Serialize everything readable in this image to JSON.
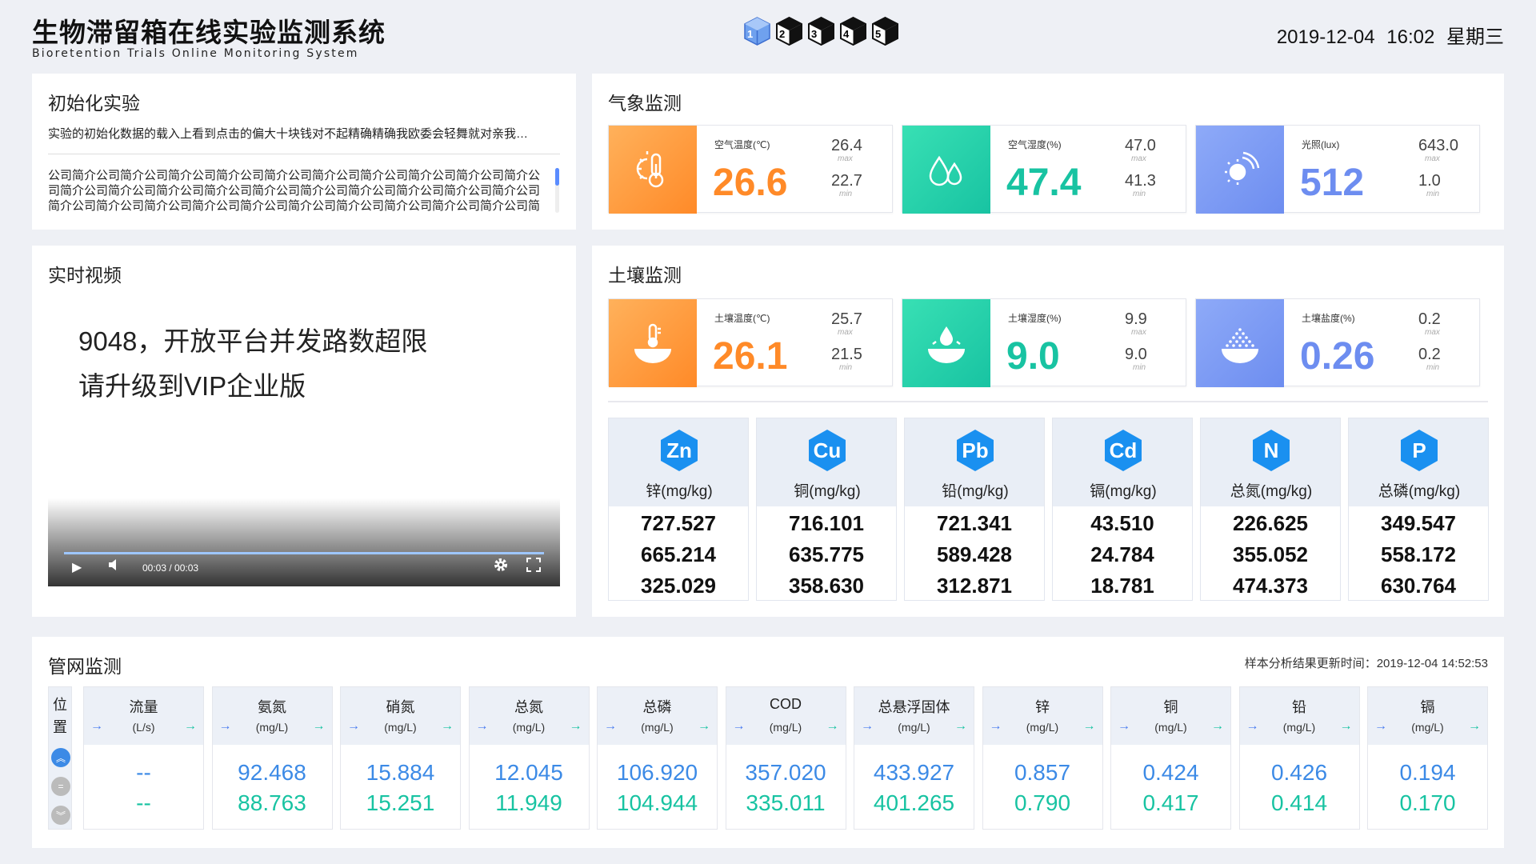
{
  "header": {
    "title_cn": "生物滞留箱在线实验监测系统",
    "title_en": "Bioretention Trials Online Monitoring System",
    "cubes": [
      "1",
      "2",
      "3",
      "4",
      "5"
    ],
    "datetime": "2019-12-04  16:02  星期三"
  },
  "init": {
    "title": "初始化实验",
    "summary": "实验的初始化数据的载入上看到点击的偏大十块钱对不起精确精确我欧委会轻舞就对亲我…",
    "body": "公司简介公司简介公司简介公司简介公司简介公司简介公司简介公司简介公司简介公司简介公司简介公司简介公司简介公司简介公司简介公司简介公司简介公司简介公司简介公司简介公司简介公司简介公司简介公司简介公司简介公司简介公司简介公司简介公司简介公司简介公司简介公司简介公司简介公司简介公司简介公司简介公司简介公司简介公司简介公司简介公"
  },
  "video": {
    "title": "实时视频",
    "message_line1": "9048，开放平台并发路数超限",
    "message_line2": "请升级到VIP企业版",
    "time": "00:03 / 00:03"
  },
  "weather": {
    "title": "气象监测",
    "cards": [
      {
        "label": "空气温度(℃)",
        "value": "26.6",
        "max": "26.4",
        "min": "22.7",
        "icon": "thermometer-sun-icon",
        "color": "#ff8a28"
      },
      {
        "label": "空气湿度(%)",
        "value": "47.4",
        "max": "47.0",
        "min": "41.3",
        "icon": "water-drops-icon",
        "color": "#18c3a2"
      },
      {
        "label": "光照(lux)",
        "value": "512",
        "max": "643.0",
        "min": "1.0",
        "icon": "sun-icon",
        "color": "#6d8df0"
      }
    ]
  },
  "soil": {
    "title": "土壤监测",
    "cards": [
      {
        "label": "土壤温度(℃)",
        "value": "26.1",
        "max": "25.7",
        "min": "21.5",
        "icon": "soil-temperature-icon"
      },
      {
        "label": "土壤湿度(%)",
        "value": "9.0",
        "max": "9.9",
        "min": "9.0",
        "icon": "soil-moisture-icon"
      },
      {
        "label": "土壤盐度(%)",
        "value": "0.26",
        "max": "0.2",
        "min": "0.2",
        "icon": "soil-salinity-icon"
      }
    ],
    "elements": [
      {
        "symbol": "Zn",
        "name": "锌(mg/kg)",
        "values": [
          "727.527",
          "665.214",
          "325.029"
        ]
      },
      {
        "symbol": "Cu",
        "name": "铜(mg/kg)",
        "values": [
          "716.101",
          "635.775",
          "358.630"
        ]
      },
      {
        "symbol": "Pb",
        "name": "铅(mg/kg)",
        "values": [
          "721.341",
          "589.428",
          "312.871"
        ]
      },
      {
        "symbol": "Cd",
        "name": "镉(mg/kg)",
        "values": [
          "43.510",
          "24.784",
          "18.781"
        ]
      },
      {
        "symbol": "N",
        "name": "总氮(mg/kg)",
        "values": [
          "226.625",
          "355.052",
          "474.373"
        ]
      },
      {
        "symbol": "P",
        "name": "总磷(mg/kg)",
        "values": [
          "349.547",
          "558.172",
          "630.764"
        ]
      }
    ]
  },
  "labels": {
    "max": "max",
    "min": "min"
  },
  "pipe": {
    "title": "管网监测",
    "update": "样本分析结果更新时间：2019-12-04 14:52:53",
    "position_label": "位置",
    "columns": [
      {
        "name": "流量",
        "unit": "(L/s)",
        "v1": "--",
        "v2": "--"
      },
      {
        "name": "氨氮",
        "unit": "(mg/L)",
        "v1": "92.468",
        "v2": "88.763"
      },
      {
        "name": "硝氮",
        "unit": "(mg/L)",
        "v1": "15.884",
        "v2": "15.251"
      },
      {
        "name": "总氮",
        "unit": "(mg/L)",
        "v1": "12.045",
        "v2": "11.949"
      },
      {
        "name": "总磷",
        "unit": "(mg/L)",
        "v1": "106.920",
        "v2": "104.944"
      },
      {
        "name": "COD",
        "unit": "(mg/L)",
        "v1": "357.020",
        "v2": "335.011"
      },
      {
        "name": "总悬浮固体",
        "unit": "(mg/L)",
        "v1": "433.927",
        "v2": "401.265"
      },
      {
        "name": "锌",
        "unit": "(mg/L)",
        "v1": "0.857",
        "v2": "0.790"
      },
      {
        "name": "铜",
        "unit": "(mg/L)",
        "v1": "0.424",
        "v2": "0.417"
      },
      {
        "name": "铅",
        "unit": "(mg/L)",
        "v1": "0.426",
        "v2": "0.414"
      },
      {
        "name": "镉",
        "unit": "(mg/L)",
        "v1": "0.194",
        "v2": "0.170"
      }
    ]
  }
}
